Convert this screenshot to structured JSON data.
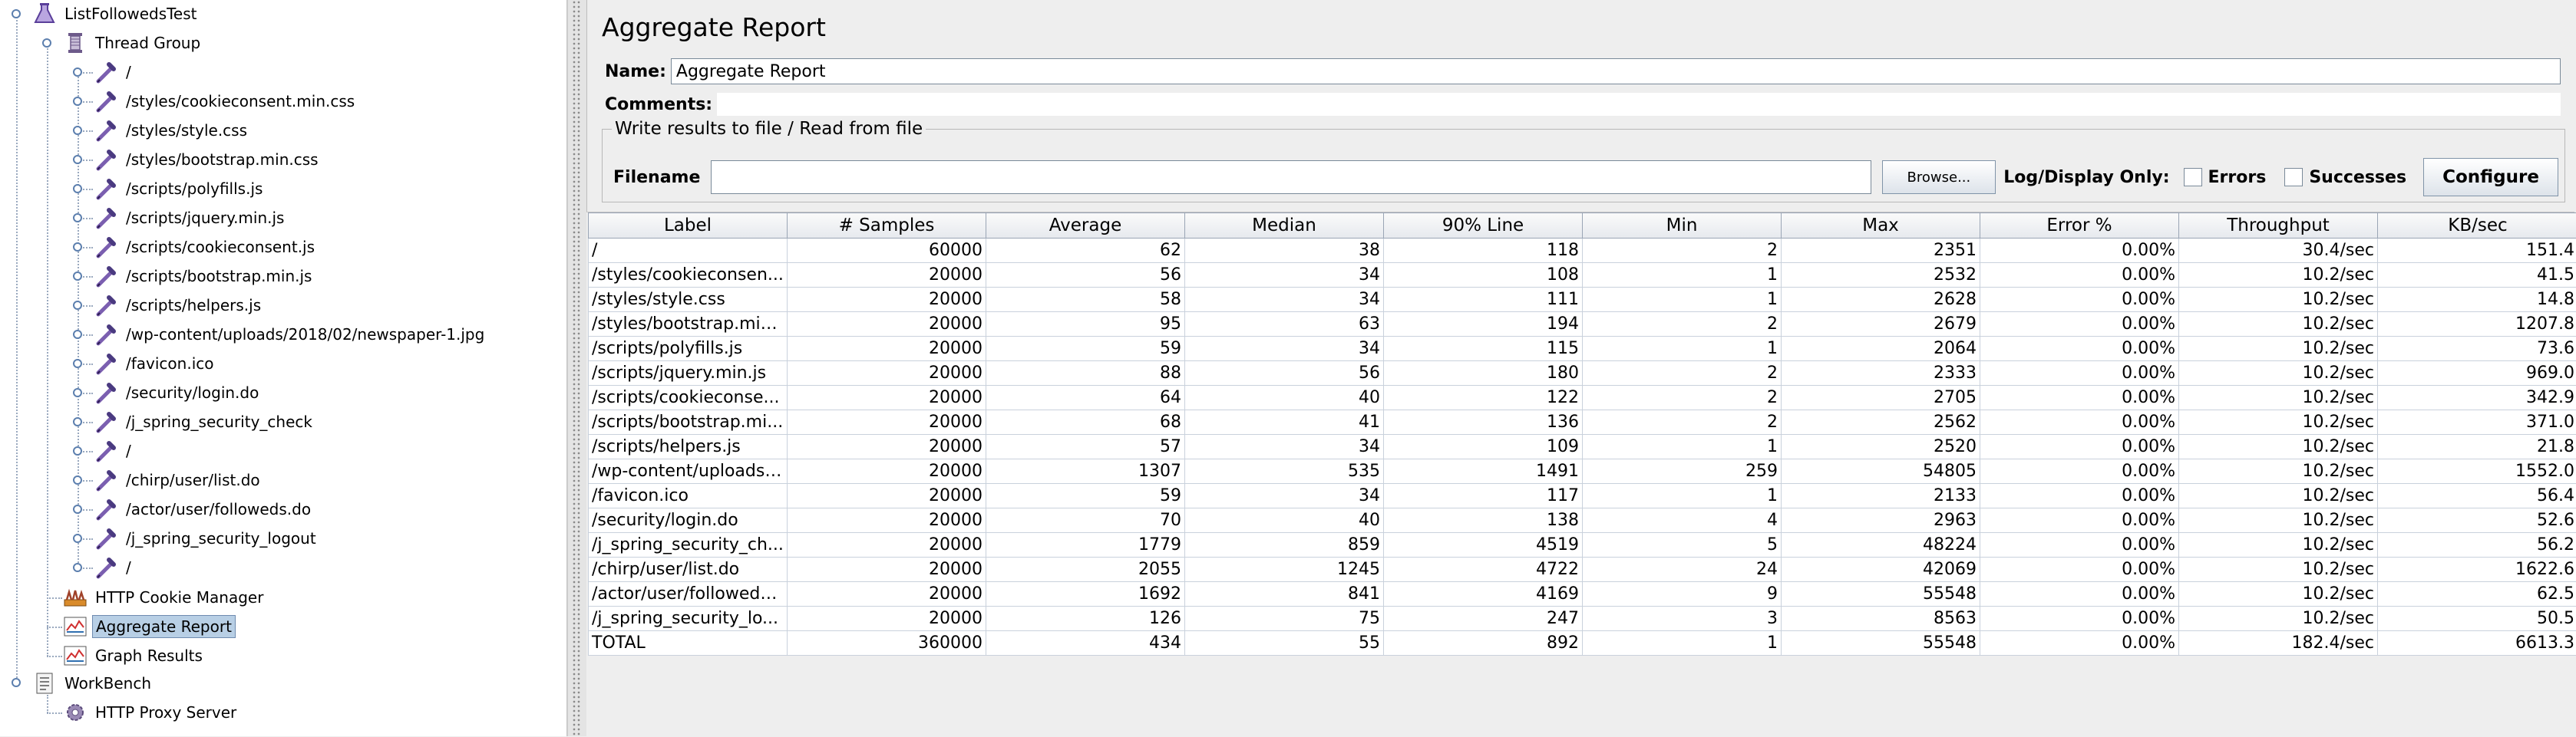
{
  "tree": {
    "root": "ListFollowedsTest",
    "thread_group": "Thread Group",
    "samplers": [
      "/",
      "/styles/cookieconsent.min.css",
      "/styles/style.css",
      "/styles/bootstrap.min.css",
      "/scripts/polyfills.js",
      "/scripts/jquery.min.js",
      "/scripts/cookieconsent.js",
      "/scripts/bootstrap.min.js",
      "/scripts/helpers.js",
      "/wp-content/uploads/2018/02/newspaper-1.jpg",
      "/favicon.ico",
      "/security/login.do",
      "/j_spring_security_check",
      "/",
      "/chirp/user/list.do",
      "/actor/user/followeds.do",
      "/j_spring_security_logout",
      "/"
    ],
    "cookie_manager": "HTTP Cookie Manager",
    "aggregate_report": "Aggregate Report",
    "graph_results": "Graph Results",
    "workbench": "WorkBench",
    "proxy_server": "HTTP Proxy Server"
  },
  "panel": {
    "title": "Aggregate Report",
    "name_label": "Name:",
    "name_value": "Aggregate Report",
    "comments_label": "Comments:",
    "file_group_title": "Write results to file / Read from file",
    "filename_label": "Filename",
    "filename_value": "",
    "browse_label": "Browse...",
    "log_display_label": "Log/Display Only:",
    "errors_label": "Errors",
    "successes_label": "Successes",
    "configure_label": "Configure"
  },
  "table": {
    "headers": [
      "Label",
      "# Samples",
      "Average",
      "Median",
      "90% Line",
      "Min",
      "Max",
      "Error %",
      "Throughput",
      "KB/sec"
    ],
    "rows": [
      [
        "/",
        "60000",
        "62",
        "38",
        "118",
        "2",
        "2351",
        "0.00%",
        "30.4/sec",
        "151.4"
      ],
      [
        "/styles/cookieconsen...",
        "20000",
        "56",
        "34",
        "108",
        "1",
        "2532",
        "0.00%",
        "10.2/sec",
        "41.5"
      ],
      [
        "/styles/style.css",
        "20000",
        "58",
        "34",
        "111",
        "1",
        "2628",
        "0.00%",
        "10.2/sec",
        "14.8"
      ],
      [
        "/styles/bootstrap.min....",
        "20000",
        "95",
        "63",
        "194",
        "2",
        "2679",
        "0.00%",
        "10.2/sec",
        "1207.8"
      ],
      [
        "/scripts/polyfills.js",
        "20000",
        "59",
        "34",
        "115",
        "1",
        "2064",
        "0.00%",
        "10.2/sec",
        "73.6"
      ],
      [
        "/scripts/jquery.min.js",
        "20000",
        "88",
        "56",
        "180",
        "2",
        "2333",
        "0.00%",
        "10.2/sec",
        "969.0"
      ],
      [
        "/scripts/cookieconse...",
        "20000",
        "64",
        "40",
        "122",
        "2",
        "2705",
        "0.00%",
        "10.2/sec",
        "342.9"
      ],
      [
        "/scripts/bootstrap.mi...",
        "20000",
        "68",
        "41",
        "136",
        "2",
        "2562",
        "0.00%",
        "10.2/sec",
        "371.0"
      ],
      [
        "/scripts/helpers.js",
        "20000",
        "57",
        "34",
        "109",
        "1",
        "2520",
        "0.00%",
        "10.2/sec",
        "21.8"
      ],
      [
        "/wp-content/uploads/...",
        "20000",
        "1307",
        "535",
        "1491",
        "259",
        "54805",
        "0.00%",
        "10.2/sec",
        "1552.0"
      ],
      [
        "/favicon.ico",
        "20000",
        "59",
        "34",
        "117",
        "1",
        "2133",
        "0.00%",
        "10.2/sec",
        "56.4"
      ],
      [
        "/security/login.do",
        "20000",
        "70",
        "40",
        "138",
        "4",
        "2963",
        "0.00%",
        "10.2/sec",
        "52.6"
      ],
      [
        "/j_spring_security_ch...",
        "20000",
        "1779",
        "859",
        "4519",
        "5",
        "48224",
        "0.00%",
        "10.2/sec",
        "56.2"
      ],
      [
        "/chirp/user/list.do",
        "20000",
        "2055",
        "1245",
        "4722",
        "24",
        "42069",
        "0.00%",
        "10.2/sec",
        "1622.6"
      ],
      [
        "/actor/user/followeds....",
        "20000",
        "1692",
        "841",
        "4169",
        "9",
        "55548",
        "0.00%",
        "10.2/sec",
        "62.5"
      ],
      [
        "/j_spring_security_lo...",
        "20000",
        "126",
        "75",
        "247",
        "3",
        "8563",
        "0.00%",
        "10.2/sec",
        "50.5"
      ],
      [
        "TOTAL",
        "360000",
        "434",
        "55",
        "892",
        "1",
        "55548",
        "0.00%",
        "182.4/sec",
        "6613.3"
      ]
    ]
  },
  "colors": {
    "selection": "#b8cfe5",
    "sampler_icon": "#7b5fb0",
    "flask_icon": "#8b6fc0"
  },
  "icons": {
    "root": "flask-icon",
    "thread_group": "spool-icon",
    "sampler": "pipette-icon",
    "cookie_manager": "config-element-icon",
    "listener": "chart-listener-icon",
    "workbench": "workbench-icon",
    "proxy": "gear-icon"
  }
}
